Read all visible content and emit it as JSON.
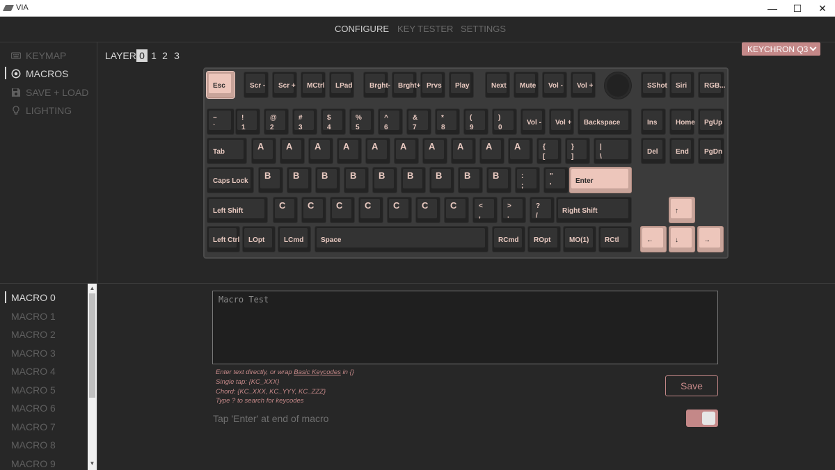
{
  "window": {
    "title": "VIA",
    "minimize": "—",
    "maximize": "☐",
    "close": "✕"
  },
  "nav": {
    "tabs": [
      {
        "label": "CONFIGURE"
      },
      {
        "label": "KEY TESTER"
      },
      {
        "label": "SETTINGS"
      }
    ],
    "active": 0
  },
  "sidebar": {
    "items": [
      {
        "label": "KEYMAP",
        "icon": "keyboard-icon"
      },
      {
        "label": "MACROS",
        "icon": "record-icon"
      },
      {
        "label": "SAVE + LOAD",
        "icon": "floppy-disk-icon"
      },
      {
        "label": "LIGHTING",
        "icon": "lightbulb-icon"
      }
    ],
    "active": 1
  },
  "layers": {
    "label": "LAYER",
    "options": [
      "0",
      "1",
      "2",
      "3"
    ],
    "active": 0
  },
  "keyboard_select": {
    "label": "KEYCHRON Q3"
  },
  "keys": [
    {
      "l": "Esc",
      "pink": true
    },
    {
      "l": "Scr -"
    },
    {
      "l": "Scr +"
    },
    {
      "l": "MCtrl"
    },
    {
      "l": "LPad"
    },
    {
      "l": "Brght-"
    },
    {
      "l": "Brght+"
    },
    {
      "l": "Prvs"
    },
    {
      "l": "Play"
    },
    {
      "l": "Next"
    },
    {
      "l": "Mute"
    },
    {
      "l": "Vol -"
    },
    {
      "l": "Vol +"
    },
    {
      "l": "SShot"
    },
    {
      "l": "Siri"
    },
    {
      "l": "RGB..."
    },
    {
      "l": "~",
      "l2": "`"
    },
    {
      "l": "!",
      "l2": "1"
    },
    {
      "l": "@",
      "l2": "2"
    },
    {
      "l": "#",
      "l2": "3"
    },
    {
      "l": "$",
      "l2": "4"
    },
    {
      "l": "%",
      "l2": "5"
    },
    {
      "l": "^",
      "l2": "6"
    },
    {
      "l": "&",
      "l2": "7"
    },
    {
      "l": "*",
      "l2": "8"
    },
    {
      "l": "(",
      "l2": "9"
    },
    {
      "l": ")",
      "l2": "0"
    },
    {
      "l": "Vol -"
    },
    {
      "l": "Vol +"
    },
    {
      "l": "Backspace"
    },
    {
      "l": "Ins"
    },
    {
      "l": "Home"
    },
    {
      "l": "PgUp"
    },
    {
      "l": "Tab"
    },
    {
      "l": "A",
      "big": true
    },
    {
      "l": "A",
      "big": true
    },
    {
      "l": "A",
      "big": true
    },
    {
      "l": "A",
      "big": true
    },
    {
      "l": "A",
      "big": true
    },
    {
      "l": "A",
      "big": true
    },
    {
      "l": "A",
      "big": true
    },
    {
      "l": "A",
      "big": true
    },
    {
      "l": "A",
      "big": true
    },
    {
      "l": "A",
      "big": true
    },
    {
      "l": "{",
      "l2": "["
    },
    {
      "l": "}",
      "l2": "]"
    },
    {
      "l": "|",
      "l2": "\\"
    },
    {
      "l": "Del"
    },
    {
      "l": "End"
    },
    {
      "l": "PgDn"
    },
    {
      "l": "Caps Lock"
    },
    {
      "l": "B",
      "big": true
    },
    {
      "l": "B",
      "big": true
    },
    {
      "l": "B",
      "big": true
    },
    {
      "l": "B",
      "big": true
    },
    {
      "l": "B",
      "big": true
    },
    {
      "l": "B",
      "big": true
    },
    {
      "l": "B",
      "big": true
    },
    {
      "l": "B",
      "big": true
    },
    {
      "l": "B",
      "big": true
    },
    {
      "l": ":",
      "l2": ";"
    },
    {
      "l": "\"",
      "l2": "'"
    },
    {
      "l": "Enter",
      "pink": true
    },
    {
      "l": "Left Shift"
    },
    {
      "l": "C",
      "big": true
    },
    {
      "l": "C",
      "big": true
    },
    {
      "l": "C",
      "big": true
    },
    {
      "l": "C",
      "big": true
    },
    {
      "l": "C",
      "big": true
    },
    {
      "l": "C",
      "big": true
    },
    {
      "l": "C",
      "big": true
    },
    {
      "l": "<",
      "l2": ","
    },
    {
      "l": ">",
      "l2": "."
    },
    {
      "l": "?",
      "l2": "/"
    },
    {
      "l": "Right Shift"
    },
    {
      "l": "↑",
      "pink": true
    },
    {
      "l": "Left Ctrl"
    },
    {
      "l": "LOpt"
    },
    {
      "l": "LCmd"
    },
    {
      "l": "Space"
    },
    {
      "l": "RCmd"
    },
    {
      "l": "ROpt"
    },
    {
      "l": "MO(1)"
    },
    {
      "l": "RCtl"
    },
    {
      "l": "←",
      "pink": true
    },
    {
      "l": "↓",
      "pink": true
    },
    {
      "l": "→",
      "pink": true
    }
  ],
  "macros": {
    "items": [
      "MACRO 0",
      "MACRO 1",
      "MACRO 2",
      "MACRO 3",
      "MACRO 4",
      "MACRO 5",
      "MACRO 6",
      "MACRO 7",
      "MACRO 8",
      "MACRO 9"
    ],
    "active": 0
  },
  "editor": {
    "placeholder": "Macro Test",
    "help_prefix": "Enter text directly, or wrap ",
    "help_link": "Basic Keycodes",
    "help_suffix": " in {}",
    "help_single": "Single tap: {KC_XXX}",
    "help_chord": "Chord: {KC_XXX, KC_YYY, KC_ZZZ}",
    "help_search": "Type ? to search for keycodes",
    "save_label": "Save",
    "enter_label": "Tap 'Enter' at end of macro",
    "enter_toggle_on": true
  },
  "colors": {
    "accent": "#c48888",
    "key_pink": "#edc6bb",
    "key_dark": "#333333",
    "background": "#272727"
  }
}
